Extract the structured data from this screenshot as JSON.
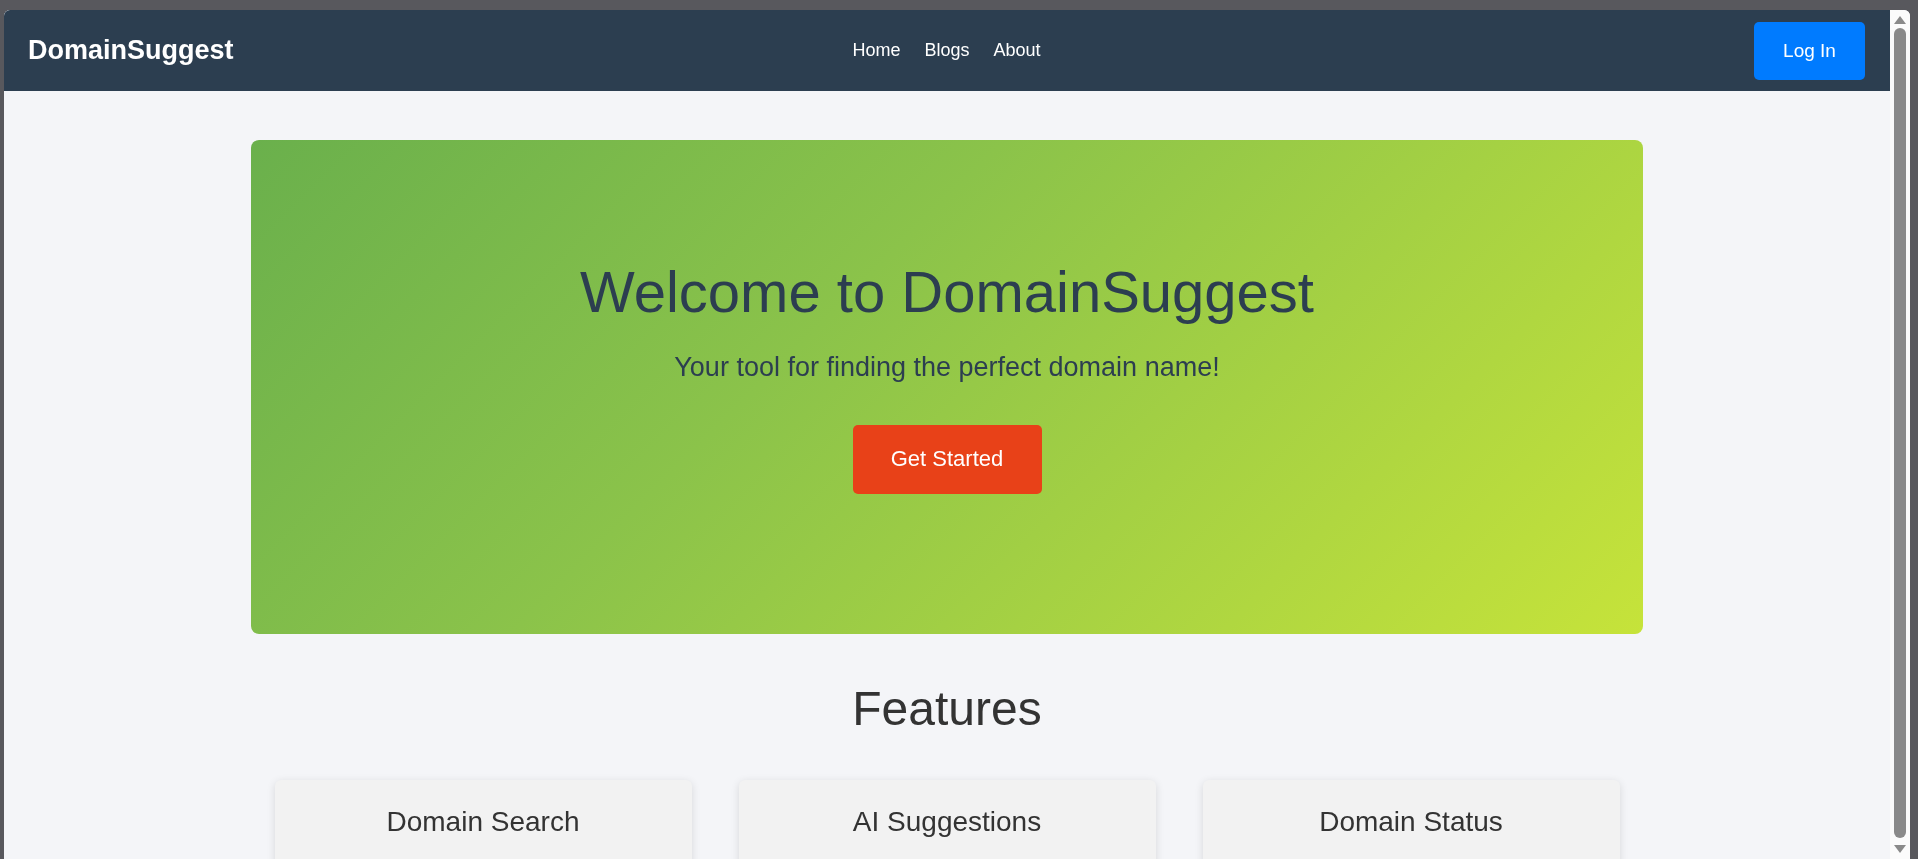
{
  "header": {
    "logo": "DomainSuggest",
    "nav": [
      "Home",
      "Blogs",
      "About"
    ],
    "login_button": "Log In"
  },
  "hero": {
    "title": "Welcome to DomainSuggest",
    "subtitle": "Your tool for finding the perfect domain name!",
    "button": "Get Started"
  },
  "features": {
    "heading": "Features",
    "cards": [
      {
        "title": "Domain Search"
      },
      {
        "title": "AI Suggestions"
      },
      {
        "title": "Domain Status"
      }
    ]
  }
}
